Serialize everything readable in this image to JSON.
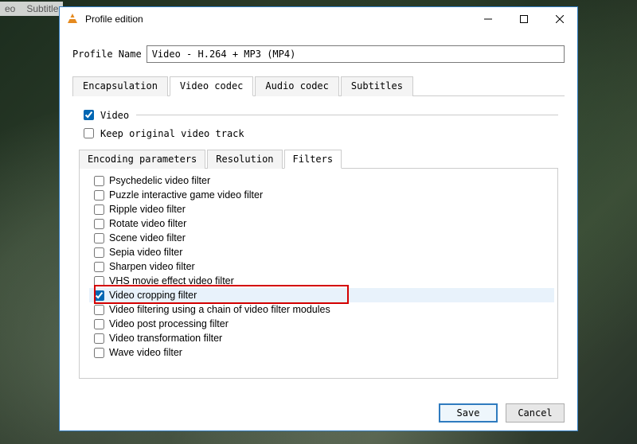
{
  "menu_fragments": [
    "eo",
    "Subtitle"
  ],
  "dialog": {
    "title": "Profile edition",
    "profile_label": "Profile Name",
    "profile_value": "Video - H.264 + MP3 (MP4)",
    "tabs": [
      {
        "label": "Encapsulation",
        "active": false
      },
      {
        "label": "Video codec",
        "active": true
      },
      {
        "label": "Audio codec",
        "active": false
      },
      {
        "label": "Subtitles",
        "active": false
      }
    ],
    "video_check": {
      "label": "Video",
      "checked": true
    },
    "keep_check": {
      "label": "Keep original video track",
      "checked": false
    },
    "subtabs": [
      {
        "label": "Encoding parameters",
        "active": false
      },
      {
        "label": "Resolution",
        "active": false
      },
      {
        "label": "Filters",
        "active": true
      }
    ],
    "filters": [
      {
        "label": "Psychedelic video filter",
        "checked": false,
        "selected": false
      },
      {
        "label": "Puzzle interactive game video filter",
        "checked": false,
        "selected": false
      },
      {
        "label": "Ripple video filter",
        "checked": false,
        "selected": false
      },
      {
        "label": "Rotate video filter",
        "checked": false,
        "selected": false
      },
      {
        "label": "Scene video filter",
        "checked": false,
        "selected": false
      },
      {
        "label": "Sepia video filter",
        "checked": false,
        "selected": false
      },
      {
        "label": "Sharpen video filter",
        "checked": false,
        "selected": false
      },
      {
        "label": "VHS movie effect video filter",
        "checked": false,
        "selected": false
      },
      {
        "label": "Video cropping filter",
        "checked": true,
        "selected": true
      },
      {
        "label": "Video filtering using a chain of video filter modules",
        "checked": false,
        "selected": false
      },
      {
        "label": "Video post processing filter",
        "checked": false,
        "selected": false
      },
      {
        "label": "Video transformation filter",
        "checked": false,
        "selected": false
      },
      {
        "label": "Wave video filter",
        "checked": false,
        "selected": false
      }
    ],
    "highlight_index": 8,
    "buttons": {
      "save": "Save",
      "cancel": "Cancel"
    }
  }
}
